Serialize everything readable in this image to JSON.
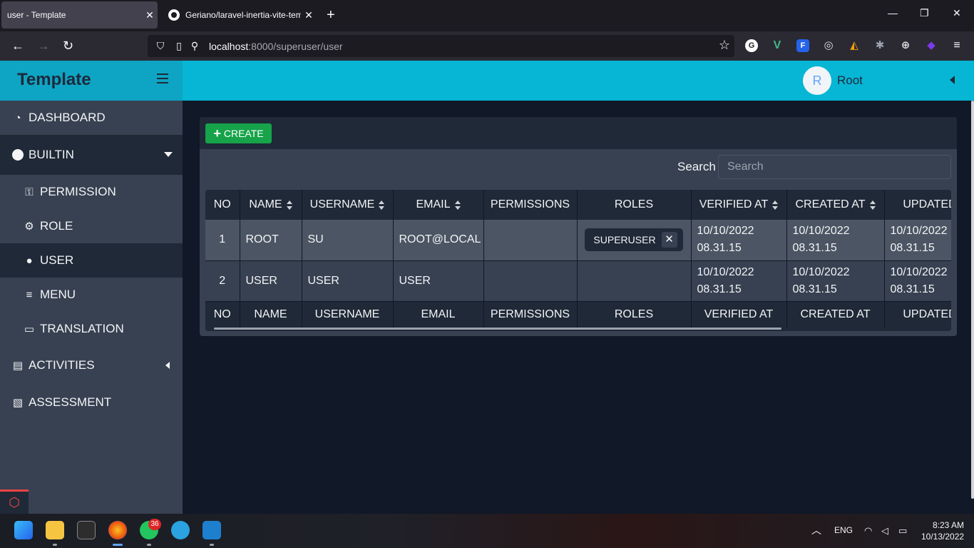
{
  "browser": {
    "active_tab_title": "user - Template",
    "inactive_tab_title": "Geriano/laravel-inertia-vite-tem",
    "url_host": "localhost",
    "url_rest": ":8000/superuser/user"
  },
  "header": {
    "brand": "Template",
    "avatar_letter": "R",
    "user_name": "Root"
  },
  "sidebar": {
    "items": [
      {
        "label": "DASHBOARD",
        "icon": "dashboard-icon"
      },
      {
        "label": "BUILTIN",
        "icon": "circle-icon"
      },
      {
        "label": "PERMISSION",
        "icon": "key-icon"
      },
      {
        "label": "ROLE",
        "icon": "user-gear-icon"
      },
      {
        "label": "USER",
        "icon": "user-icon"
      },
      {
        "label": "MENU",
        "icon": "menu-icon"
      },
      {
        "label": "TRANSLATION",
        "icon": "translation-icon"
      },
      {
        "label": "ACTIVITIES",
        "icon": "id-card-icon"
      },
      {
        "label": "ASSESSMENT",
        "icon": "file-clock-icon"
      }
    ]
  },
  "main": {
    "create_label": "CREATE",
    "search_label": "Search",
    "search_placeholder": "Search",
    "columns": [
      "NO",
      "NAME",
      "USERNAME",
      "EMAIL",
      "PERMISSIONS",
      "ROLES",
      "VERIFIED AT",
      "CREATED AT",
      "UPDATED"
    ],
    "rows": [
      {
        "no": "1",
        "name": "ROOT",
        "username": "SU",
        "email": "ROOT@LOCAL",
        "permissions": "",
        "role": "SUPERUSER",
        "verified_date": "10/10/2022",
        "verified_time": "08.31.15",
        "created_date": "10/10/2022",
        "created_time": "08.31.15",
        "updated_date": "10/10/2022",
        "updated_time": "08.31.15"
      },
      {
        "no": "2",
        "name": "USER",
        "username": "USER",
        "email": "USER",
        "permissions": "",
        "role": "",
        "verified_date": "10/10/2022",
        "verified_time": "08.31.15",
        "created_date": "10/10/2022",
        "created_time": "08.31.15",
        "updated_date": "10/10/2022",
        "updated_time": "08.31.15"
      }
    ]
  },
  "taskbar": {
    "whatsapp_badge": "36",
    "language": "ENG",
    "time": "8:23 AM",
    "date": "10/13/2022"
  }
}
